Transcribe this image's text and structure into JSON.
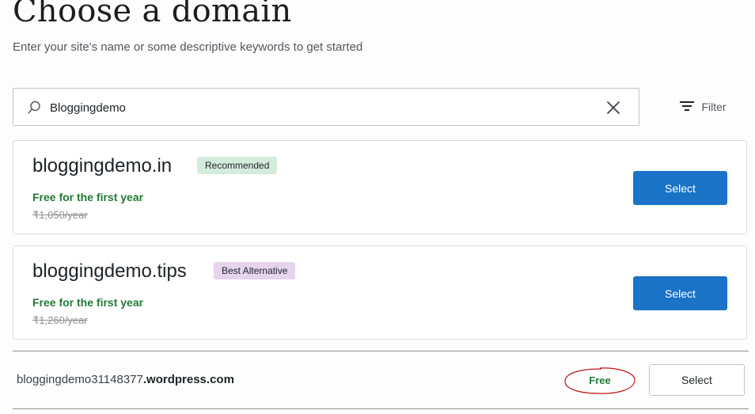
{
  "header": {
    "title": "Choose a domain",
    "subtitle": "Enter your site's name or some descriptive keywords to get started"
  },
  "search": {
    "value": "Bloggingdemo",
    "icon": "search-icon",
    "clear_icon": "close-icon"
  },
  "filter": {
    "label": "Filter",
    "icon": "filter-icon"
  },
  "results": [
    {
      "domain": "bloggingdemo.in",
      "badge": "Recommended",
      "badge_color": "#d4ecdc",
      "offer": "Free for the first year",
      "price": "₹1,050/year",
      "button": "Select"
    },
    {
      "domain": "bloggingdemo.tips",
      "badge": "Best Alternative",
      "badge_color": "#e6d3ec",
      "offer": "Free for the first year",
      "price": "₹1,260/year",
      "button": "Select"
    }
  ],
  "free_option": {
    "subdomain": "bloggingdemo31148377",
    "suffix": ".wordpress.com",
    "price_label": "Free",
    "button": "Select"
  },
  "colors": {
    "accent": "#1a73c6",
    "success": "#1f7a35",
    "annotation": "#c0141a"
  }
}
